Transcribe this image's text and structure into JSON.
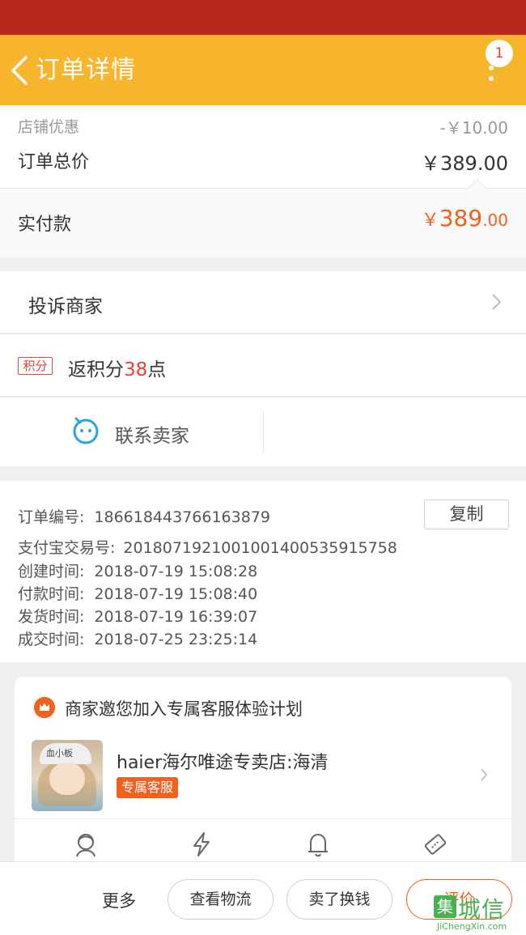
{
  "header": {
    "title": "订单详情",
    "badge_count": "1"
  },
  "price": {
    "shop_discount_label": "店铺优惠",
    "shop_discount_value": "-￥10.00",
    "total_label": "订单总价",
    "total_value": "￥389.00",
    "paid_label": "实付款",
    "paid_currency": "￥",
    "paid_int": "389",
    "paid_dec": ".00"
  },
  "complain": {
    "label": "投诉商家"
  },
  "points": {
    "tag": "积分",
    "prefix": "返积分",
    "num": "38",
    "suffix": "点"
  },
  "contact": {
    "label": "联系卖家"
  },
  "order_info": {
    "copy_label": "复制",
    "rows": [
      {
        "k": "订单编号:",
        "v": "186618443766163879"
      },
      {
        "k": "支付宝交易号:",
        "v": "2018071921001001400535915758"
      },
      {
        "k": "创建时间:",
        "v": "2018-07-19 15:08:28"
      },
      {
        "k": "付款时间:",
        "v": "2018-07-19 15:08:40"
      },
      {
        "k": "发货时间:",
        "v": "2018-07-19 16:39:07"
      },
      {
        "k": "成交时间:",
        "v": "2018-07-25 23:25:14"
      }
    ]
  },
  "service_card": {
    "title": "商家邀您加入专属客服体验计划",
    "shop_name": "haier海尔唯途专卖店:海清",
    "tag": "专属客服",
    "avatar_text": "血小板",
    "icons": [
      "service-icon",
      "lightning-icon",
      "bell-icon",
      "ticket-icon"
    ]
  },
  "bottom": {
    "more": "更多",
    "logistics": "查看物流",
    "sell": "卖了换钱",
    "review": "评价"
  },
  "watermark": {
    "box": "集",
    "text": "城信",
    "sub": "JiChengXin.com"
  },
  "colors": {
    "header": "#f7b52c",
    "status_bar": "#b7271e",
    "accent": "#f0601e",
    "points": "#e8413a"
  }
}
